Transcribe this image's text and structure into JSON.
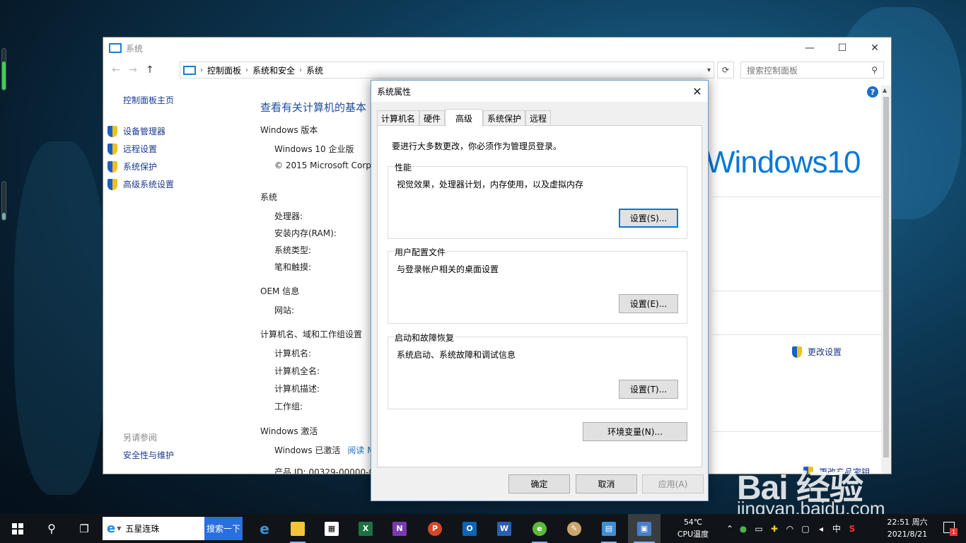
{
  "syswin": {
    "title": "系统",
    "controls": {
      "min": "—",
      "max": "☐",
      "close": "✕"
    },
    "breadcrumb": [
      "控制面板",
      "系统和安全",
      "系统"
    ],
    "search_placeholder": "搜索控制面板",
    "left_nav": {
      "home": "控制面板主页",
      "items": [
        "设备管理器",
        "远程设置",
        "系统保护",
        "高级系统设置"
      ],
      "see_also": "另请参阅",
      "security": "安全性与维护"
    },
    "heading": "查看有关计算机的基本",
    "edition_section": "Windows 版本",
    "edition": "Windows 10 企业版",
    "copyright": "© 2015 Microsoft Corp",
    "system_section": "系统",
    "system_labels": [
      "处理器:",
      "安装内存(RAM):",
      "系统类型:",
      "笔和触摸:"
    ],
    "oem_section": "OEM 信息",
    "oem_labels": [
      "网站:"
    ],
    "computer_section": "计算机名、域和工作组设置",
    "computer_labels": [
      "计算机名:",
      "计算机全名:",
      "计算机描述:",
      "工作组:"
    ],
    "change_settings": "更改设置",
    "activation_section": "Windows 激活",
    "activated": "Windows 已激活",
    "read_link": "阅读 M",
    "product_id": "产品 ID: 00329-00000-0",
    "change_key": "更改产品密钥",
    "brand": "Windows10",
    "help": "?"
  },
  "dialog": {
    "title": "系统属性",
    "close": "✕",
    "tabs": [
      "计算机名",
      "硬件",
      "高级",
      "系统保护",
      "远程"
    ],
    "active_tab": "高级",
    "admin_note": "要进行大多数更改，你必须作为管理员登录。",
    "performance": {
      "label": "性能",
      "desc": "视觉效果，处理器计划，内存使用，以及虚拟内存",
      "button": "设置(S)..."
    },
    "profiles": {
      "label": "用户配置文件",
      "desc": "与登录帐户相关的桌面设置",
      "button": "设置(E)..."
    },
    "startup": {
      "label": "启动和故障恢复",
      "desc": "系统启动、系统故障和调试信息",
      "button": "设置(T)..."
    },
    "env_button": "环境变量(N)...",
    "ok": "确定",
    "cancel": "取消",
    "apply": "应用(A)"
  },
  "taskbar": {
    "search_text": "五星连珠",
    "search_button": "搜索一下",
    "temp_value": "54℃",
    "temp_label": "CPU温度",
    "ime": "中",
    "time": "22:51 周六",
    "date": "2021/8/21",
    "notif_count": "1",
    "apps": [
      "edge-icon",
      "file-explorer-icon",
      "store-icon",
      "excel-icon",
      "onenote-icon",
      "powerpoint-icon",
      "outlook-icon",
      "word-icon",
      "browser-icon",
      "paint-icon",
      "control-panel-icon",
      "system-icon"
    ]
  },
  "watermark": {
    "brand": "Bai 经验",
    "url": "jingyan.baidu.com"
  },
  "colors": {
    "accent": "#0078d7",
    "link": "#1a3a8f",
    "brand_blue": "#0a78d7"
  }
}
